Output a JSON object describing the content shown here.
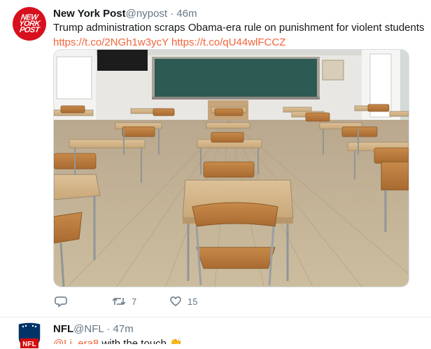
{
  "tweet1": {
    "avatar_lines": [
      "NEW",
      "YORK",
      "POST"
    ],
    "name": "New York Post",
    "handle": "@nypost",
    "separator": "·",
    "time": "46m",
    "text": "Trump administration scraps Obama-era rule on punishment for violent students",
    "links": [
      "https://t.co/2NGh1w3ycY",
      "https://t.co/qU44wlFCCZ"
    ],
    "actions": {
      "reply_count": "",
      "retweet_count": "7",
      "like_count": "15"
    }
  },
  "tweet2": {
    "avatar_text": "NFL",
    "name": "NFL",
    "handle": "@NFL",
    "separator": "·",
    "time": "47m",
    "mention": "@Li_era8",
    "text": " with the touch "
  },
  "colors": {
    "link": "#f2643a",
    "secondary": "#657786",
    "nypost_red": "#d8101d",
    "nfl_blue": "#013369",
    "nfl_red": "#d50a0a"
  }
}
